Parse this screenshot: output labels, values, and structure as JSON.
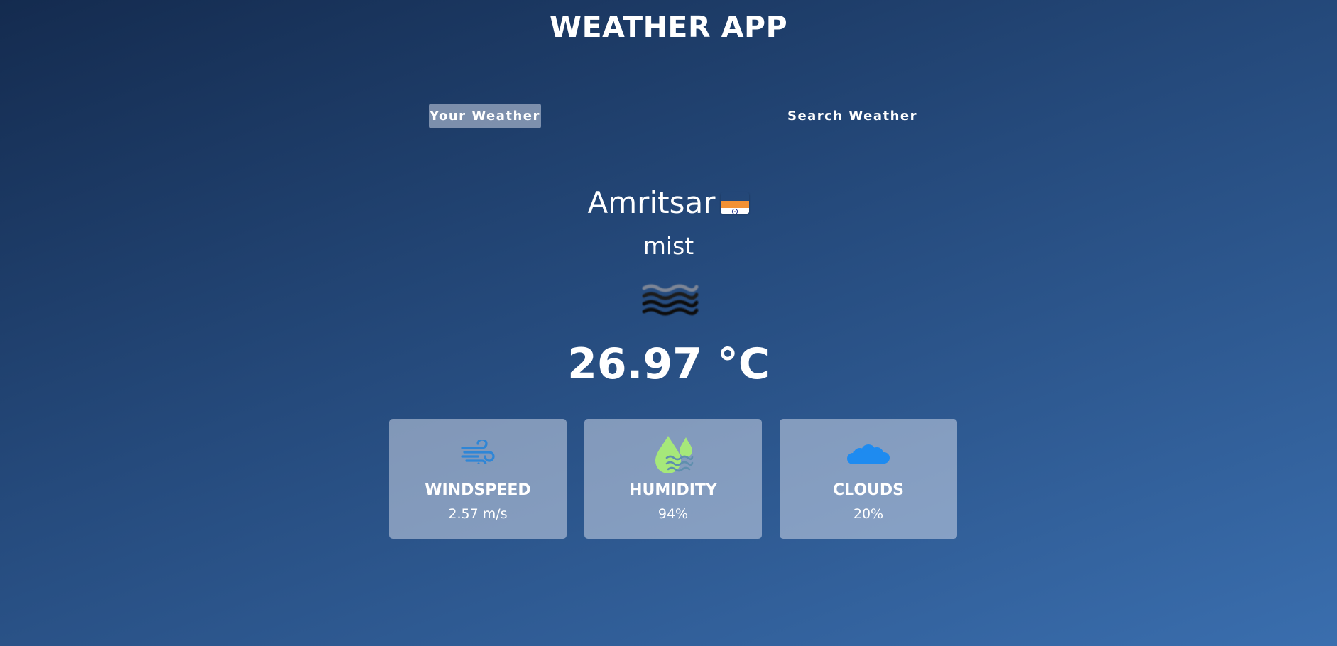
{
  "header": {
    "title": "WEATHER APP"
  },
  "tabs": [
    {
      "label": "Your Weather",
      "active": true
    },
    {
      "label": "Search Weather",
      "active": false
    }
  ],
  "weather": {
    "city": "Amritsar",
    "country_flag": "india-flag-icon",
    "description": "mist",
    "icon": "mist-icon",
    "temperature": "26.97 °C"
  },
  "stats": [
    {
      "label": "WINDSPEED",
      "value": "2.57 m/s",
      "icon": "wind-icon",
      "icon_color": "#2f86d6"
    },
    {
      "label": "HUMIDITY",
      "value": "94%",
      "icon": "humidity-icon",
      "icon_color": "#a6e87a"
    },
    {
      "label": "CLOUDS",
      "value": "20%",
      "icon": "clouds-icon",
      "icon_color": "#1e8bf0"
    }
  ]
}
